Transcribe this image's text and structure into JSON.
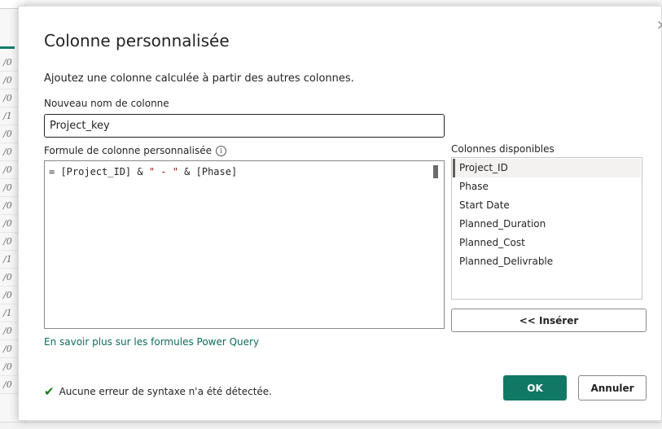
{
  "background": {
    "row_fragments": [
      "/0",
      "/0",
      "/0",
      "/1",
      "/0",
      "/0",
      "/0",
      "/0",
      "/0",
      "/0",
      "/0",
      "/1",
      "/0",
      "/0",
      "/1",
      "/0",
      "/0",
      "/0",
      "/0"
    ]
  },
  "dialog": {
    "title": "Colonne personnalisée",
    "subtitle": "Ajoutez une colonne calculée à partir des autres colonnes.",
    "close_icon": "×",
    "name_label": "Nouveau nom de colonne",
    "name_value": "Project_key",
    "formula_label": "Formule de colonne personnalisée",
    "info_icon": "i",
    "formula": {
      "prefix": "= [Project_ID] & ",
      "string": "\" - \"",
      "suffix": " & [Phase]"
    },
    "available_label": "Colonnes disponibles",
    "available_columns": [
      "Project_ID",
      "Phase",
      "Start Date",
      "Planned_Duration",
      "Planned_Cost",
      "Planned_Delivrable"
    ],
    "selected_column": "Project_ID",
    "insert_label": "<< Insérer",
    "learn_link": "En savoir plus sur les formules Power Query",
    "status_icon": "✔",
    "status_text": "Aucune erreur de syntaxe n'a été détectée.",
    "ok_label": "OK",
    "cancel_label": "Annuler"
  },
  "colors": {
    "accent": "#117865",
    "link": "#0e6b5f",
    "success": "#107c10"
  }
}
